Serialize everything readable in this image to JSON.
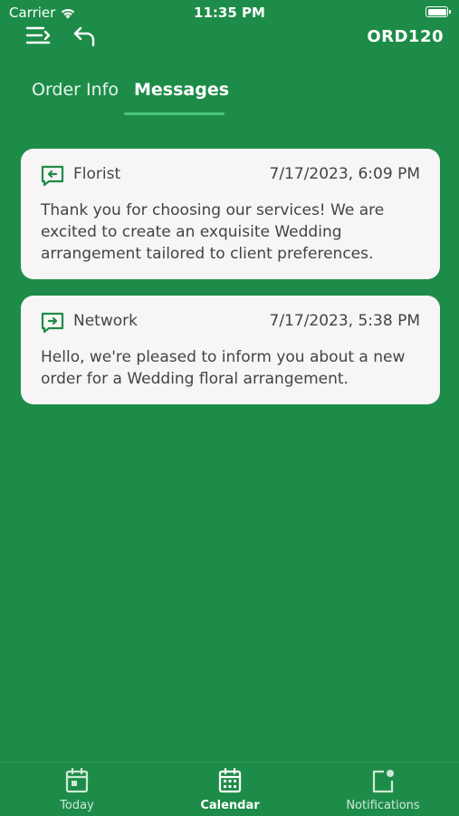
{
  "status_bar": {
    "carrier": "Carrier",
    "time": "11:35 PM"
  },
  "header": {
    "order_id": "ORD120"
  },
  "tabs": [
    {
      "label": "Order Info",
      "active": false
    },
    {
      "label": "Messages",
      "active": true
    }
  ],
  "messages": [
    {
      "sender": "Florist",
      "timestamp": "7/17/2023, 6:09 PM",
      "body": "Thank you for choosing our services! We are excited to create an exquisite Wedding arrangement tailored to client preferences.",
      "icon": "message-outgoing-icon"
    },
    {
      "sender": "Network",
      "timestamp": "7/17/2023, 5:38 PM",
      "body": "Hello, we're pleased to inform you about a new order for a Wedding floral arrangement.",
      "icon": "message-incoming-icon"
    }
  ],
  "tab_bar": {
    "items": [
      {
        "label": "Today",
        "icon": "today-calendar-icon",
        "active": false
      },
      {
        "label": "Calendar",
        "icon": "calendar-grid-icon",
        "active": true
      },
      {
        "label": "Notifications",
        "icon": "notification-icon",
        "active": false
      }
    ]
  },
  "colors": {
    "background": "#1e8c49",
    "card": "#f7f5f5",
    "accent_underline": "#4cc77a",
    "icon_green": "#1e8c49"
  }
}
